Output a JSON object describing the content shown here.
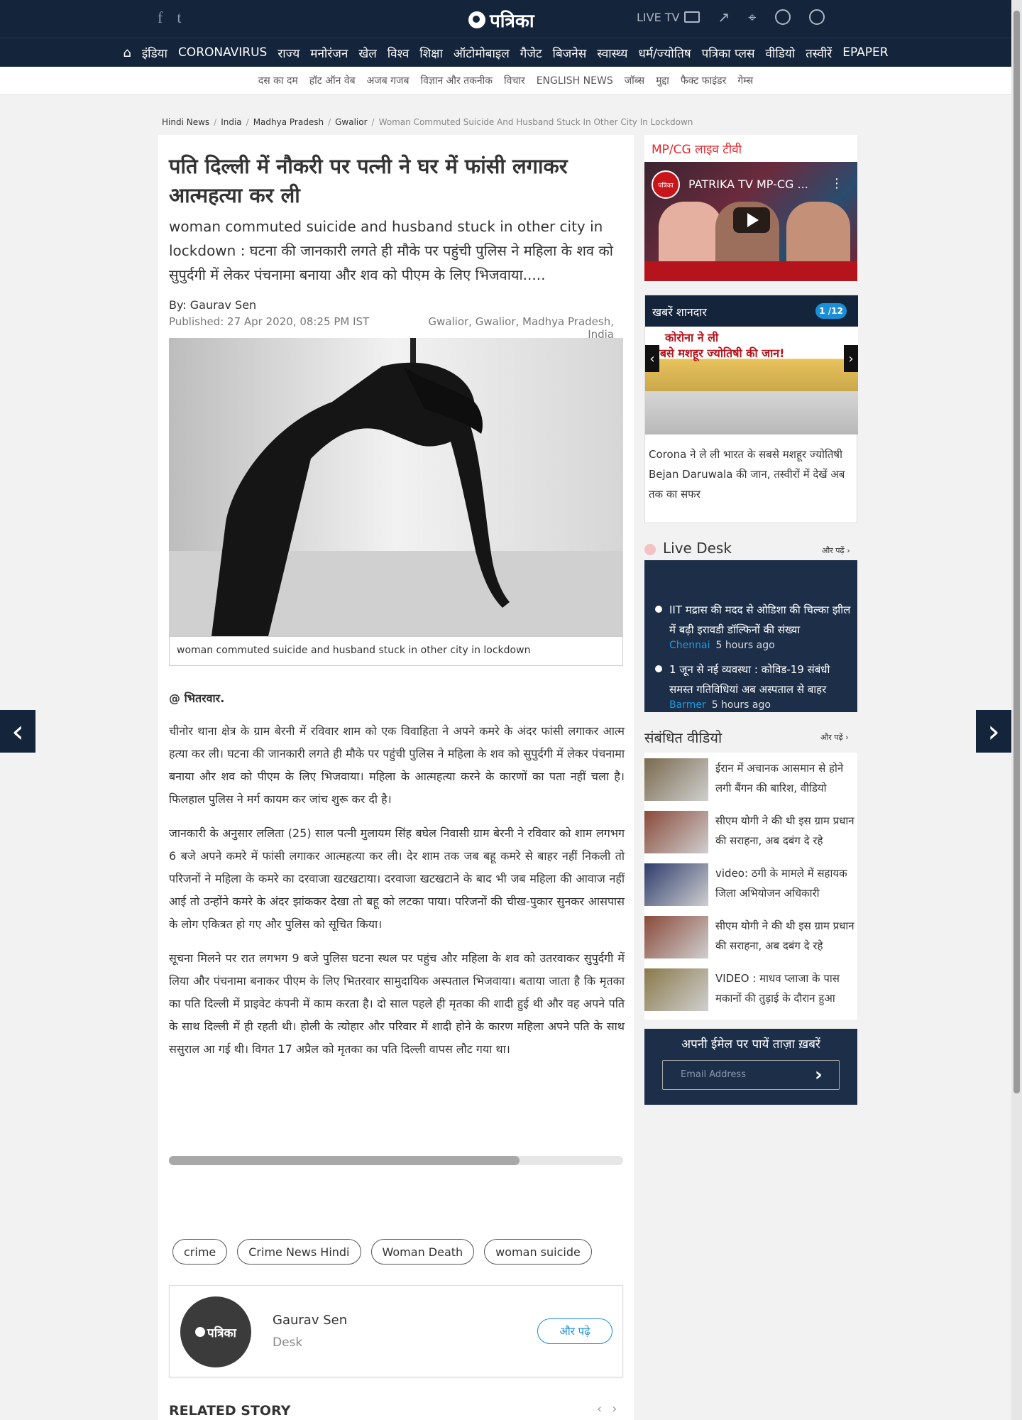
{
  "header": {
    "social": [
      "f",
      "t"
    ],
    "logo_text": "पत्रिका",
    "live_tv": "LIVE TV",
    "icons": [
      "trending-icon",
      "location-icon",
      "search-icon",
      "user-icon"
    ]
  },
  "nav": {
    "items": [
      "इंडिया",
      "CORONAVIRUS",
      "राज्य",
      "मनोरंजन",
      "खेल",
      "विश्व",
      "शिक्षा",
      "ऑटोमोबाइल",
      "गैजेट",
      "बिजनेस",
      "स्वास्थ्य",
      "धर्म/ज्योतिष",
      "पत्रिका प्लस",
      "वीडियो",
      "तस्वीरें",
      "EPAPER"
    ]
  },
  "subnav": {
    "items": [
      "दस का दम",
      "हॉट ऑन वेब",
      "अजब गजब",
      "विज्ञान और तकनीक",
      "विचार",
      "ENGLISH NEWS",
      "जॉब्स",
      "मुद्दा",
      "फैक्ट फाइंडर",
      "गेम्स"
    ]
  },
  "breadcrumb": {
    "items": [
      "Hindi News",
      "India",
      "Madhya Pradesh",
      "Gwalior"
    ],
    "current": "Woman Commuted Suicide And Husband Stuck In Other City In Lockdown"
  },
  "article": {
    "headline": "पति दिल्ली में नौकरी पर पत्नी ने घर में फांसी लगाकर आत्महत्या कर ली",
    "summary": "woman commuted suicide and husband stuck in other city in lockdown : घटना की जानकारी लगते ही मौके पर पहुंची पुलिस ने महिला के शव को सुपुर्दगी में लेकर पंचनामा बनाया और शव को पीएम के लिए भिजवाया.....",
    "byline": "By: Gaurav Sen",
    "published": "Published: 27 Apr 2020, 08:25 PM IST",
    "location": "Gwalior, Gwalior, Madhya Pradesh, India",
    "image_caption": "woman commuted suicide and husband stuck in other city in lockdown",
    "dateline": "@ भितरवार.",
    "paragraphs": [
      "चीनोर थाना क्षेत्र के ग्राम बेरनी में रविवार शाम को एक विवाहिता ने अपने कमरे के अंदर फांसी लगाकर आत्म हत्या कर ली। घटना की जानकारी लगते ही मौके पर पहुंची पुलिस ने महिला के शव को सुपुर्दगी में लेकर पंचनामा बनाया और शव को पीएम के लिए भिजवाया। महिला के आत्महत्या करने के कारणों का पता नहीं चला है। फिलहाल पुलिस ने मर्ग कायम कर जांच शुरू कर दी है।",
      "जानकारी के अनुसार ललिता (25) साल पत्नी मुलायम सिंह बघेल निवासी ग्राम बेरनी ने रविवार को शाम लगभग 6 बजे अपने कमरे में फांसी लगाकर आत्महत्या कर ली। देर शाम तक जब बहू कमरे से बाहर नहीं निकली तो परिजनों ने महिला के कमरे का दरवाजा खटखटाया। दरवाजा खटखटाने के बाद भी जब महिला की आवाज नहीं आई तो उन्होंने कमरे के अंदर झांककर देखा तो बहू को लटका पाया। परिजनों की चीख-पुकार सुनकर आसपास के लोग एकित्रत हो गए और पुलिस को सूचित किया।",
      "सूचना मिलने पर रात लगभग 9 बजे पुलिस घटना स्थल पर पहुंच और महिला के शव को उतरवाकर सुपुर्दगी में लिया और पंचनामा बनाकर पीएम के लिए भितरवार सामुदायिक अस्पताल भिजवाया। बताया जाता है कि मृतका का पति दिल्ली में प्राइवेट कंपनी में काम करता है। दो साल पहले ही मृतका की शादी हुई थी और वह अपने पति के साथ दिल्ली में ही रहती थी। होली के त्योहार और परिवार में शादी होने के कारण महिला अपने पति के साथ ससुराल आ गई थी। विगत 17 अप्रैल को मृतका का पति दिल्ली वापस लौट गया था।"
    ],
    "tags": [
      "crime",
      "Crime News Hindi",
      "Woman Death",
      "woman suicide"
    ],
    "author": {
      "avatar_text": "पत्रिका",
      "name": "Gaurav Sen",
      "role": "Desk",
      "more": "और पढ़े"
    },
    "related_title": "RELATED STORY"
  },
  "sidebar": {
    "livetv_title": "MP/CG लाइव टीवी",
    "video_title": "PATRIKA TV MP-CG ...",
    "video_logo": "पत्रिका",
    "khabren": {
      "title": "खबरें शानदार",
      "count": "1 /12",
      "image_line1": "कोरोना ने ली",
      "image_line2": "सबसे मशहूर ज्योतिषी की जान!",
      "text": "Corona ने ले ली भारत के सबसे मशहूर ज्योतिषी Bejan Daruwala की जान, तस्वीरों में देखें अब तक का सफर"
    },
    "livedesk": {
      "title": "Live Desk",
      "more": "और पढ़ें",
      "items": [
        {
          "text": "IIT मद्रास की मदद से ओडिशा की चिल्का झील में बढ़ी इरावडी डॉल्फिनों की संख्या",
          "city": "Chennai",
          "time": "5 hours ago"
        },
        {
          "text": "1 जून से नई व्यवस्था : कोविड-19 संबंधी समस्त गतिविधियां अब अस्पताल से बाहर",
          "city": "Barmer",
          "time": "5 hours ago"
        }
      ]
    },
    "videos": {
      "title": "संबंधित वीडियो",
      "more": "और पढ़ें",
      "items": [
        {
          "title": "ईरान में अचानक आसमान से होने लगी बैंगन की बारिश, वीडियो",
          "color": "#7a6a4e"
        },
        {
          "title": "सीएम योगी ने की थी इस ग्राम प्रधान की सराहना, अब दबंग दे रहे",
          "color": "#8a4a3a"
        },
        {
          "title": "video: ठगी के मामले में सहायक जिला अभियोजन अधिकारी",
          "color": "#2e3c6c"
        },
        {
          "title": "सीएम योगी ने की थी इस ग्राम प्रधान की सराहना, अब दबंग दे रहे",
          "color": "#8a4a3a"
        },
        {
          "title": "VIDEO : माधव प्लाजा के पास मकानों की तुड़ाई के दौरान हुआ",
          "color": "#8a7a4a"
        }
      ]
    },
    "email": {
      "title": "अपनी ईमेल पर पायें ताज़ा ख़बरें",
      "placeholder": "Email Address"
    }
  }
}
